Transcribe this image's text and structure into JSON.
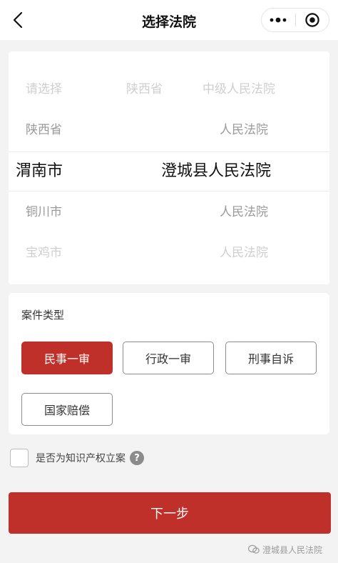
{
  "nav": {
    "title": "选择法院",
    "back_icon": "chevron-left-icon",
    "more_icon": "more-dots-icon",
    "close_icon": "target-circle-icon"
  },
  "picker": {
    "province_column": {
      "above": [
        "请选择",
        "陕西省"
      ],
      "selected": "渭南市",
      "below": [
        "铜川市",
        "宝鸡市"
      ]
    },
    "upper_middle_column": [
      "陕西省"
    ],
    "court_column": {
      "above": [
        "中级人民法院",
        "人民法院"
      ],
      "selected": "澄城县人民法院",
      "below": [
        "人民法院",
        "人民法院"
      ]
    }
  },
  "case_type": {
    "title": "案件类型",
    "options": [
      {
        "label": "民事一审",
        "active": true
      },
      {
        "label": "行政一审",
        "active": false
      },
      {
        "label": "刑事自诉",
        "active": false
      },
      {
        "label": "国家赔偿",
        "active": false
      }
    ]
  },
  "ip_case": {
    "label": "是否为知识产权立案",
    "checked": false,
    "help_glyph": "?"
  },
  "next_button": {
    "label": "下一步"
  },
  "watermark": {
    "text": "澄城县人民法院"
  },
  "colors": {
    "accent": "#c0302a",
    "background": "#f3f3f3",
    "card": "#ffffff"
  }
}
